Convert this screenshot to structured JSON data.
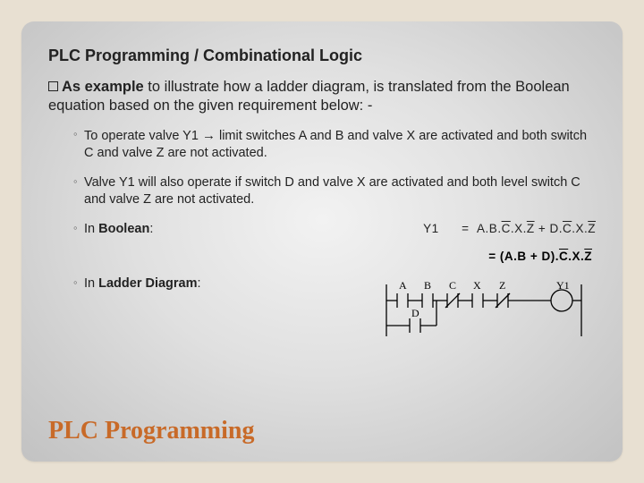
{
  "title": "PLC Programming / Combinational Logic",
  "intro": {
    "lead_bold": "As example",
    "rest": " to illustrate how a ladder diagram, is translated from the Boolean equation based on the given requirement below: -"
  },
  "bullets": {
    "b1a": "To operate valve Y1 ",
    "b1arrow": "→",
    "b1b": "   limit switches A and B and valve X are activated and both switch C and valve Z are not activated.",
    "b2": "Valve Y1 will also operate if switch D and valve X are activated and both level switch C and valve Z are not activated.",
    "b3_label": "In ",
    "b3_bold": "Boolean",
    "b3_colon": ":",
    "b4_label": "In ",
    "b4_bold": "Ladder Diagram",
    "b4_colon": ":"
  },
  "equations": {
    "lhs": "Y1",
    "rhs1": "=  A.B.C̄.X.Z̄ + D.C̄.X.Z̄",
    "rhs2": "= (A.B + D).C̄.X.Z̄"
  },
  "ladder": {
    "labels": [
      "A",
      "B",
      "C",
      "X",
      "Z",
      "Y1",
      "D"
    ]
  },
  "footer": "PLC Programming"
}
